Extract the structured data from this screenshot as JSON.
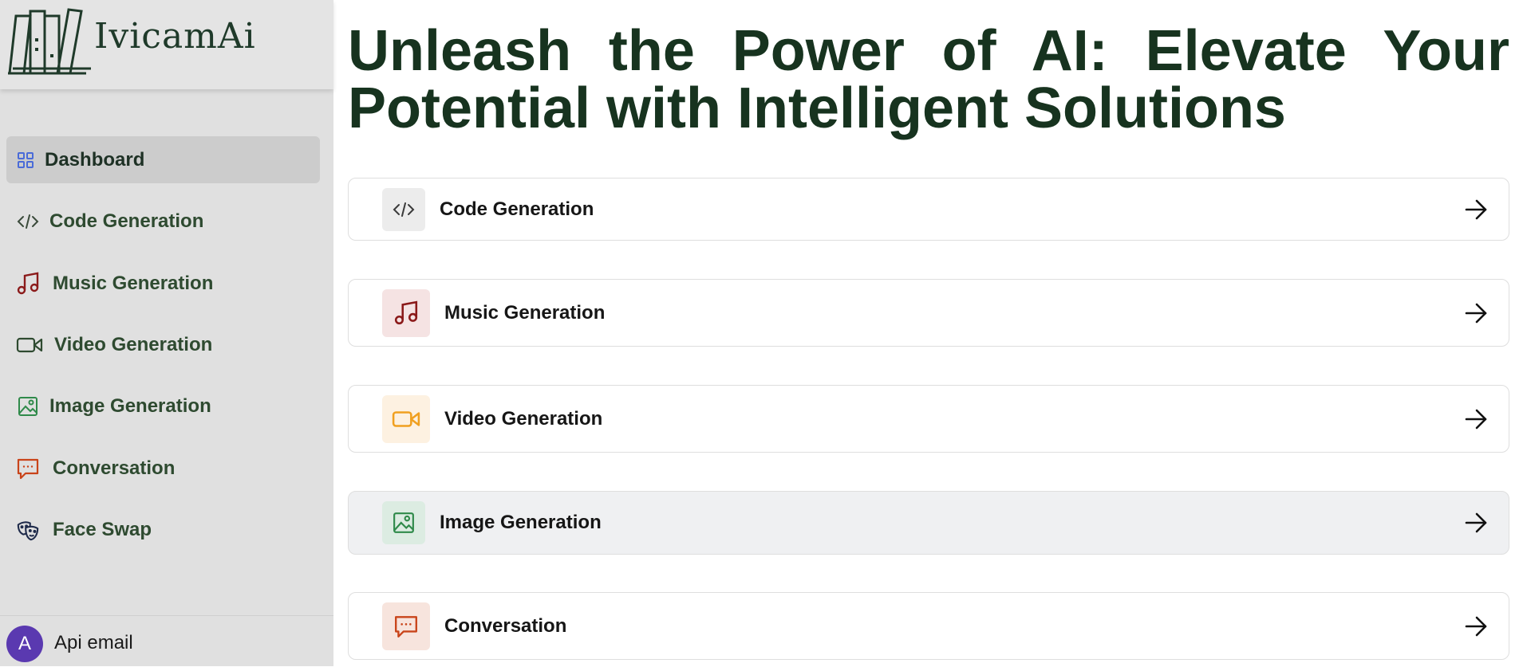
{
  "app": {
    "brand_name": "IvicamAi"
  },
  "sidebar": {
    "items": [
      {
        "label": "Dashboard",
        "icon": "grid-icon",
        "active": true
      },
      {
        "label": "Code Generation",
        "icon": "code-icon",
        "active": false
      },
      {
        "label": "Music Generation",
        "icon": "music-note-icon",
        "active": false
      },
      {
        "label": "Video Generation",
        "icon": "video-camera-icon",
        "active": false
      },
      {
        "label": "Image Generation",
        "icon": "image-icon",
        "active": false
      },
      {
        "label": "Conversation",
        "icon": "chat-bubble-icon",
        "active": false
      },
      {
        "label": "Face Swap",
        "icon": "masks-icon",
        "active": false
      }
    ],
    "account": {
      "avatar_initial": "A",
      "name": "Api email"
    }
  },
  "main": {
    "headline": "Unleash the Power of AI: Elevate Your Potential with Intelligent Solutions",
    "tools": [
      {
        "label": "Code Generation",
        "icon": "code-icon",
        "color": "#3a3a3a",
        "tile_bg": "#ececec"
      },
      {
        "label": "Music Generation",
        "icon": "music-note-icon",
        "color": "#8b1a1a",
        "tile_bg": "#f5e3e3"
      },
      {
        "label": "Video Generation",
        "icon": "video-camera-icon",
        "color": "#f0a020",
        "tile_bg": "#fdf1e1"
      },
      {
        "label": "Image Generation",
        "icon": "image-icon",
        "color": "#2f8a4a",
        "tile_bg": "#dcece2"
      },
      {
        "label": "Conversation",
        "icon": "chat-bubble-icon",
        "color": "#c9441a",
        "tile_bg": "#f7e4dd"
      }
    ],
    "arrow_icon": "arrow-right-icon"
  },
  "colors": {
    "sidebar_bg": "#e0e0e0",
    "headline": "#17331f",
    "nav_text": "#2e4a30",
    "avatar_bg": "#5a39b0"
  }
}
